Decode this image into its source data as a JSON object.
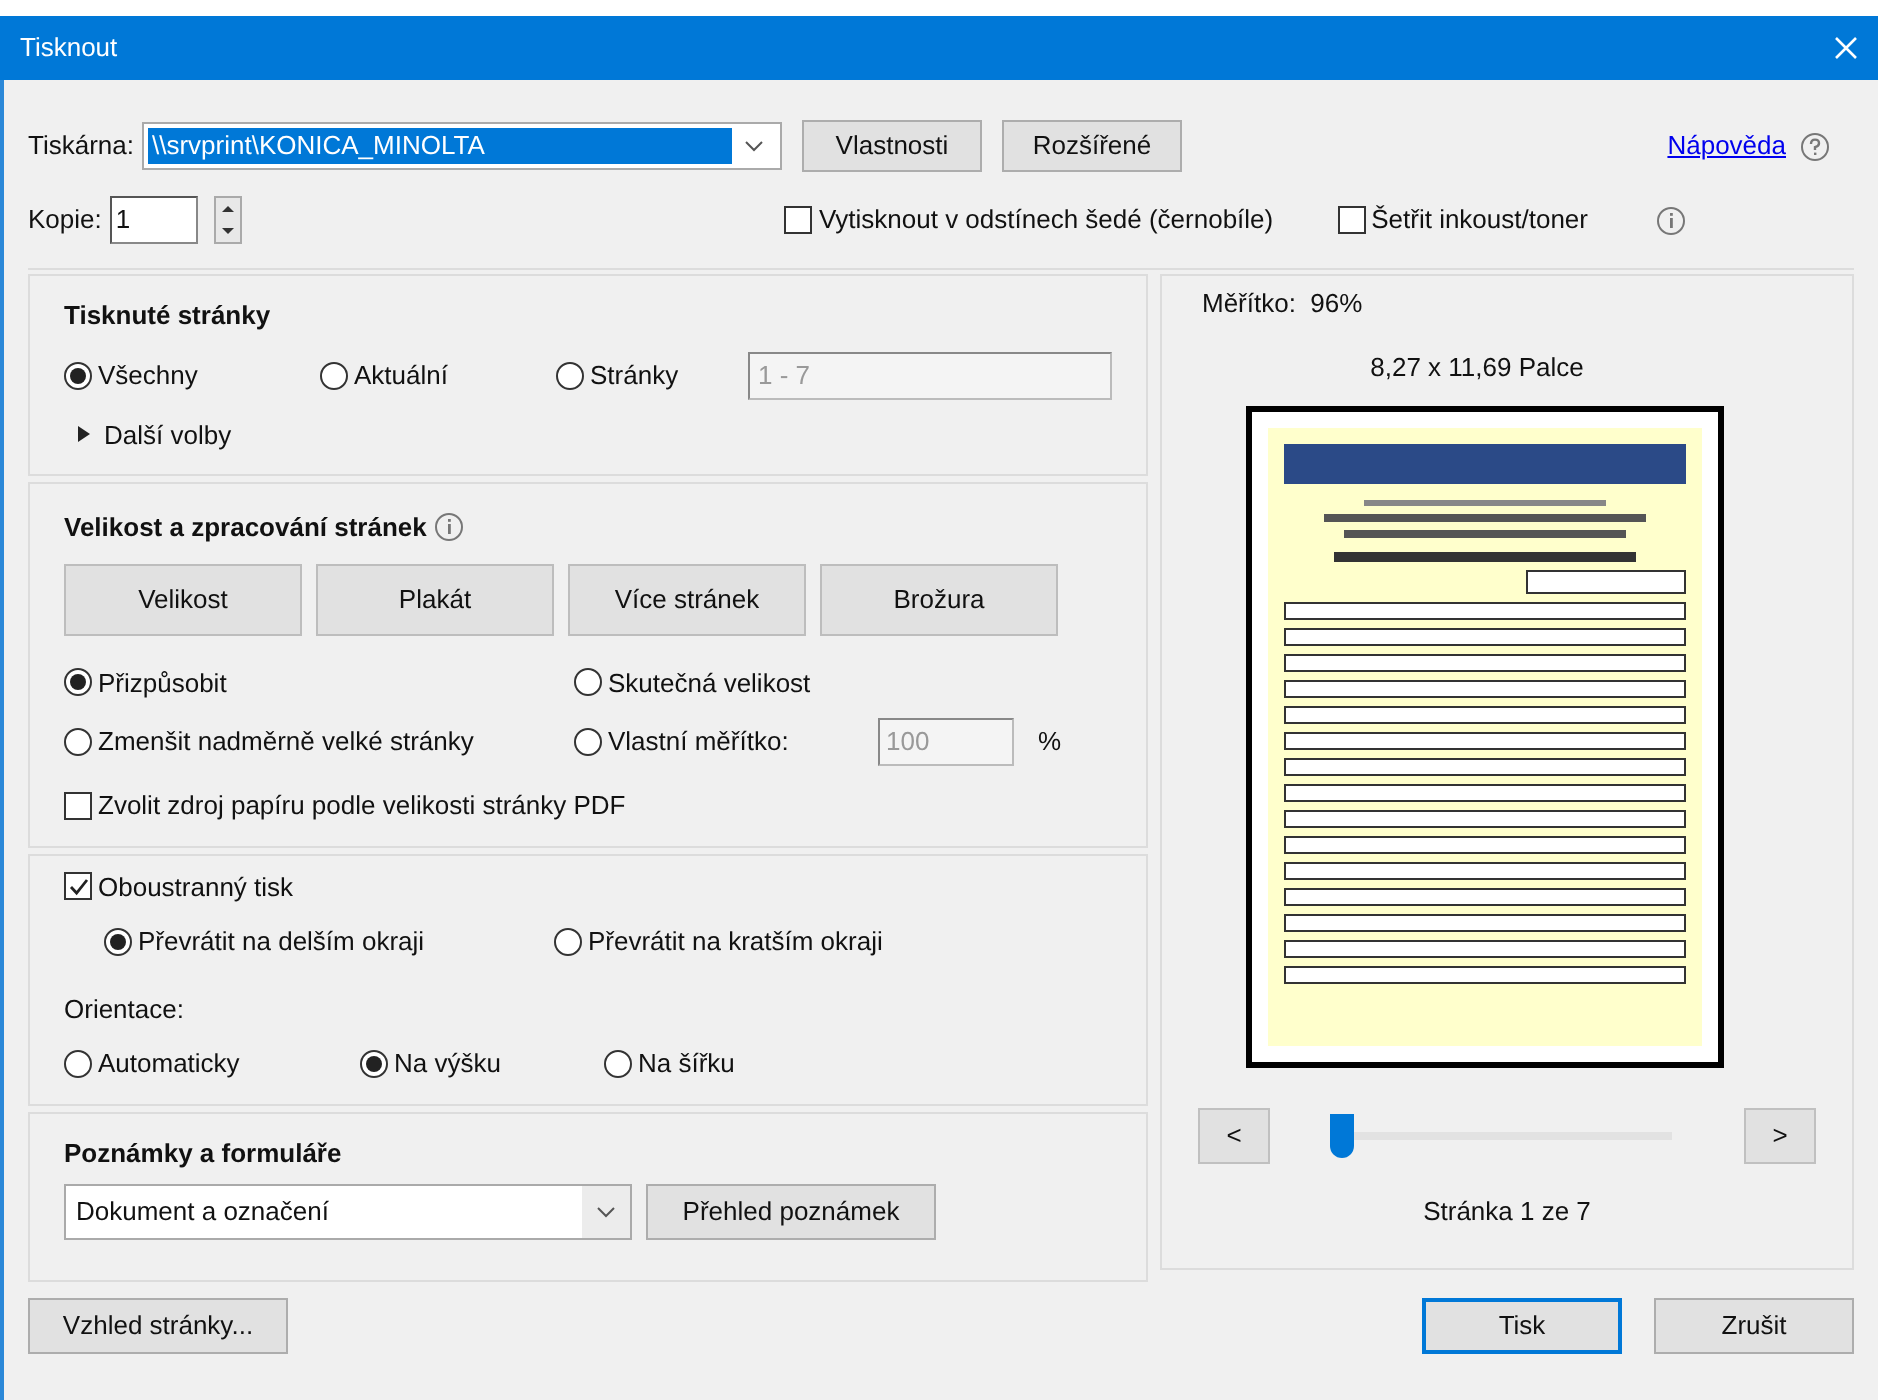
{
  "window": {
    "title": "Tisknout"
  },
  "printer": {
    "label": "Tiskárna:",
    "value": "\\\\srvprint\\KONICA_MINOLTA",
    "buttons": [
      "Vlastnosti",
      "Rozšířené"
    ]
  },
  "help_link": "Nápověda",
  "copies": {
    "label": "Kopie:",
    "value": "1"
  },
  "options": [
    {
      "label": "Vytisknout v odstínech šedé (černobíle)",
      "checked": false
    },
    {
      "label": "Šetřit inkoust/toner",
      "checked": false
    }
  ],
  "pages_section": {
    "title": "Tisknuté stránky",
    "radios": [
      {
        "label": "Všechny",
        "selected": true
      },
      {
        "label": "Aktuální",
        "selected": false
      },
      {
        "label": "Stránky",
        "selected": false
      }
    ],
    "range": {
      "value": "1 - 7",
      "disabled": true
    },
    "more": {
      "label": "Další volby",
      "expanded": false
    }
  },
  "sizing_section": {
    "title": "Velikost a zpracování stránek",
    "modes": [
      "Velikost",
      "Plakát",
      "Více stránek",
      "Brožura"
    ],
    "radios": [
      {
        "label": "Přizpůsobit",
        "selected": true
      },
      {
        "label": "Skutečná velikost",
        "selected": false
      },
      {
        "label": "Zmenšit nadměrně velké stránky",
        "selected": false
      },
      {
        "label": "Vlastní měřítko:",
        "selected": false
      }
    ],
    "custom_scale": {
      "value": "100",
      "unit": "%",
      "disabled": true
    },
    "paper_source": {
      "label": "Zvolit zdroj papíru podle velikosti stránky PDF",
      "checked": false
    }
  },
  "duplex": {
    "label": "Oboustranný tisk",
    "checked": true,
    "flip": [
      {
        "label": "Převrátit na delším okraji",
        "selected": true
      },
      {
        "label": "Převrátit na kratším okraji",
        "selected": false
      }
    ]
  },
  "orientation": {
    "label": "Orientace:",
    "options": [
      {
        "label": "Automaticky",
        "selected": false
      },
      {
        "label": "Na výšku",
        "selected": true
      },
      {
        "label": "Na šířku",
        "selected": false
      }
    ]
  },
  "notes": {
    "title": "Poznámky a formuláře",
    "value": "Dokument a označení",
    "button": "Přehled poznámek"
  },
  "preview": {
    "scale": "Měřítko:  96%",
    "paper_size": "8,27 x 11,69 Palce",
    "prev": "<",
    "next": ">",
    "slider": {
      "level": 0
    },
    "page_label": "Stránka 1 ze 7"
  },
  "footer": {
    "page_setup": "Vzhled stránky...",
    "buttons": [
      {
        "label": "Tisk",
        "kind": "default"
      },
      {
        "label": "Zrušit",
        "kind": "normal"
      }
    ]
  }
}
